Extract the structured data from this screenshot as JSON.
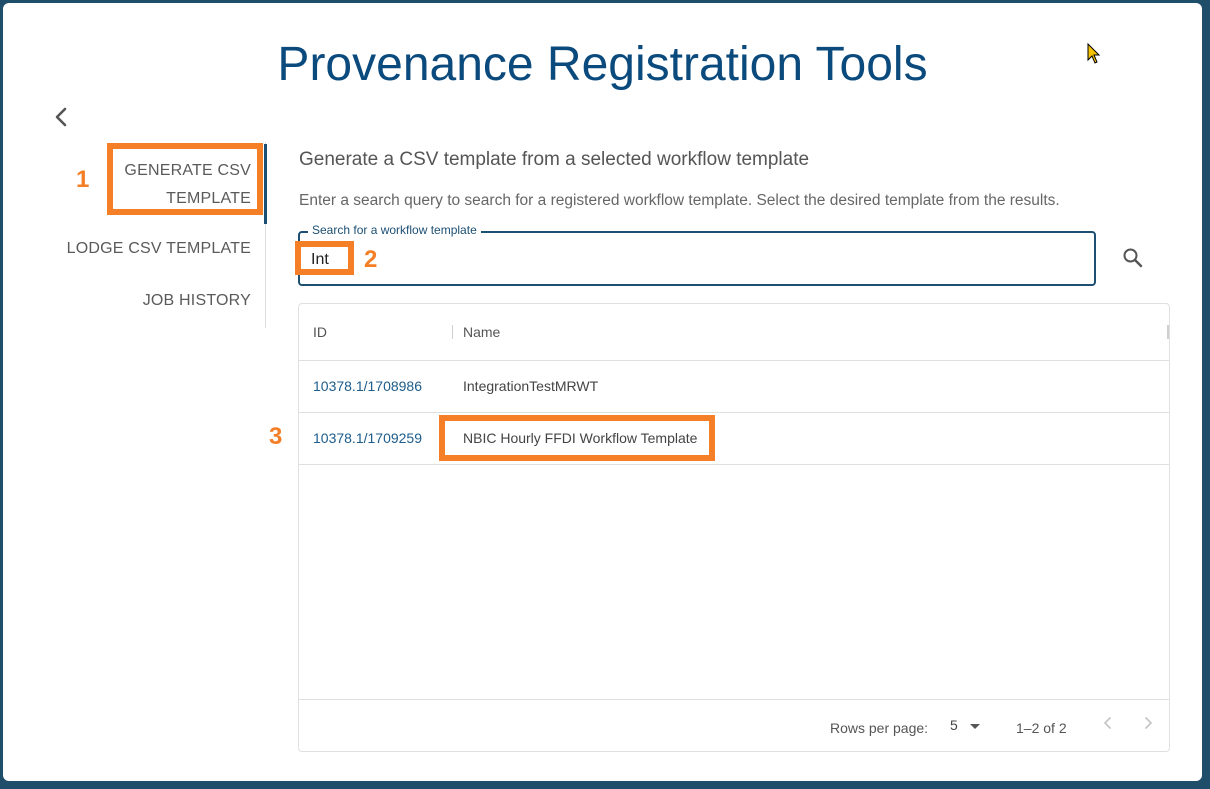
{
  "app": {
    "title": "Provenance Registration Tools"
  },
  "sidebar": {
    "items": [
      {
        "label": "GENERATE CSV TEMPLATE",
        "active": true
      },
      {
        "label": "LODGE CSV TEMPLATE",
        "active": false
      },
      {
        "label": "JOB HISTORY",
        "active": false
      }
    ]
  },
  "main": {
    "heading": "Generate a CSV template from a selected workflow template",
    "description": "Enter a search query to search for a registered workflow template. Select the desired template from the results.",
    "search": {
      "label": "Search for a workflow template",
      "value": "Int"
    },
    "table": {
      "columns": [
        "ID",
        "Name"
      ],
      "rows": [
        {
          "id": "10378.1/1708986",
          "name": "IntegrationTestMRWT"
        },
        {
          "id": "10378.1/1709259",
          "name": "NBIC Hourly FFDI Workflow Template"
        }
      ]
    },
    "pagination": {
      "rows_per_page_label": "Rows per page:",
      "rows_per_page": "5",
      "range": "1–2 of 2"
    }
  },
  "annotations": {
    "labels": [
      "1",
      "2",
      "3"
    ],
    "color": "#f47f26"
  },
  "colors": {
    "title": "#0b4a7d",
    "accent": "#1d4f73",
    "link": "#1d5c8b",
    "annotation": "#f47f26"
  }
}
